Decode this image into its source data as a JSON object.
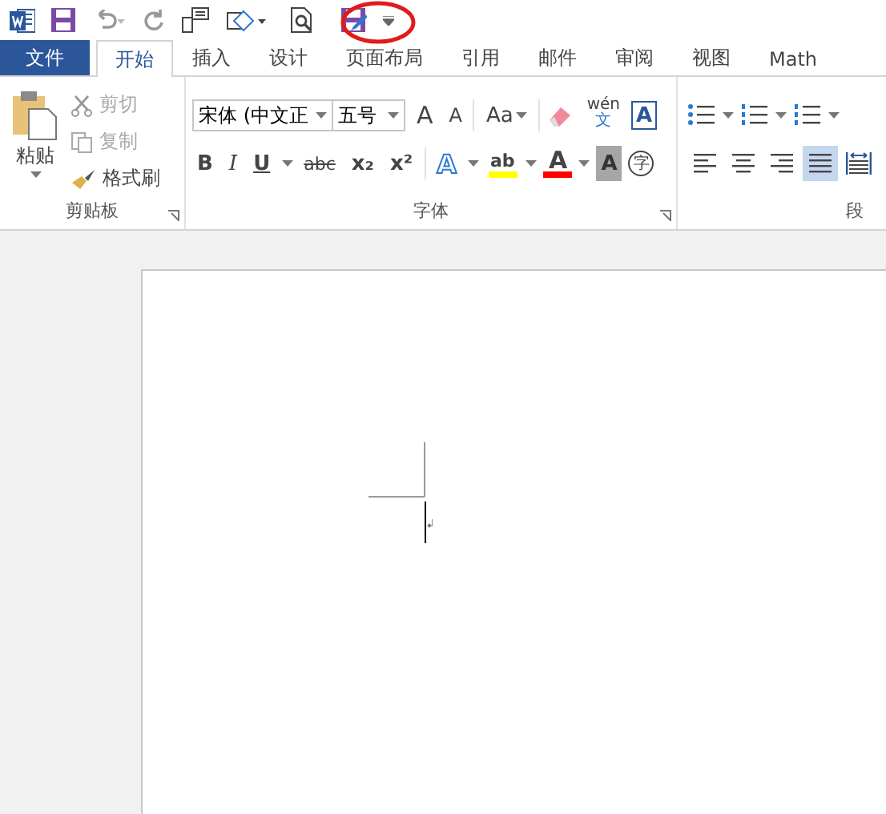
{
  "tabs": [
    {
      "label": "文件",
      "kind": "file",
      "selected": false
    },
    {
      "label": "开始",
      "kind": "tab",
      "selected": true
    },
    {
      "label": "插入",
      "kind": "tab",
      "selected": false
    },
    {
      "label": "设计",
      "kind": "tab",
      "selected": false
    },
    {
      "label": "页面布局",
      "kind": "tab",
      "selected": false
    },
    {
      "label": "引用",
      "kind": "tab",
      "selected": false
    },
    {
      "label": "邮件",
      "kind": "tab",
      "selected": false
    },
    {
      "label": "审阅",
      "kind": "tab",
      "selected": false
    },
    {
      "label": "视图",
      "kind": "tab",
      "selected": false
    },
    {
      "label": "Math",
      "kind": "tab",
      "selected": false
    }
  ],
  "clipboard": {
    "label": "剪贴板",
    "paste": "粘贴",
    "cut": {
      "label": "剪切",
      "disabled": true
    },
    "copy": {
      "label": "复制",
      "disabled": true
    },
    "format_painter": {
      "label": "格式刷",
      "disabled": false
    }
  },
  "font": {
    "label": "字体",
    "name": "宋体 (中文正",
    "size": "五号",
    "row1": [
      {
        "kind": "grow",
        "text": "A"
      },
      {
        "kind": "shrink",
        "text": "A"
      },
      {
        "kind": "case",
        "text": "Aa"
      },
      {
        "kind": "clear"
      },
      {
        "kind": "phonetic",
        "text": "wén",
        "sub": "文"
      },
      {
        "kind": "border",
        "text": "A"
      }
    ],
    "row2": [
      {
        "kind": "bold",
        "text": "B"
      },
      {
        "kind": "italic",
        "text": "I"
      },
      {
        "kind": "underline",
        "text": "U"
      },
      {
        "kind": "strike",
        "text": "abc"
      },
      {
        "kind": "sub",
        "text": "x₂"
      },
      {
        "kind": "sup",
        "text": "x²"
      },
      {
        "kind": "effect",
        "text": "A"
      },
      {
        "kind": "highlight",
        "text": "ab",
        "color": "#ffff00"
      },
      {
        "kind": "color",
        "text": "A",
        "color": "#ff0000"
      },
      {
        "kind": "shading",
        "text": "A"
      },
      {
        "kind": "enclose",
        "text": "字"
      }
    ]
  },
  "paragraph": {
    "label": "段",
    "alignment": [
      {
        "selected": false
      },
      {
        "selected": false
      },
      {
        "selected": false
      },
      {
        "selected": true
      },
      {
        "selected": false
      }
    ]
  }
}
